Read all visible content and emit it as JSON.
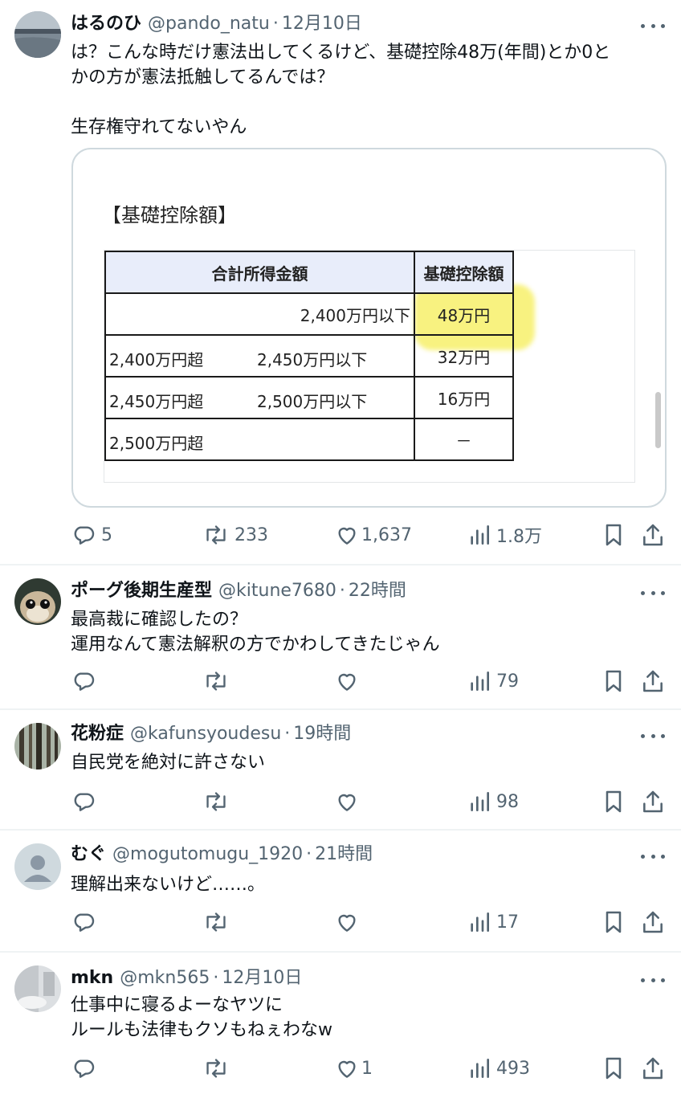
{
  "colors": {
    "text": "#0f1419",
    "muted": "#536471",
    "divider": "#eff3f4",
    "highlight": "#f7f06a",
    "header_bg": "#e8edfa"
  },
  "tweets": [
    {
      "name": "はるのひ",
      "handle": "@pando_natu",
      "time": "12月10日",
      "lines": [
        "は？こんな時だけ憲法出してくるけど、基礎控除48万(年間)とか0と",
        "かの方が憲法抵触してるんでは？",
        "",
        "生存権守れてないやん"
      ],
      "reply_count": "5",
      "retweet_count": "233",
      "like_count": "1,637",
      "view_count": "1.8万",
      "avatar": "lake-photo"
    },
    {
      "name": "ポーグ後期生産型",
      "handle": "@kitune7680",
      "time": "22時間",
      "lines": [
        "最高裁に確認したの？",
        "運用なんて憲法解釈の方でかわしてきたじゃん"
      ],
      "reply_count": "",
      "retweet_count": "",
      "like_count": "",
      "view_count": "79",
      "avatar": "porg-figure"
    },
    {
      "name": "花粉症",
      "handle": "@kafunsyoudesu",
      "time": "19時間",
      "lines": [
        "自民党を絶対に許さない"
      ],
      "reply_count": "",
      "retweet_count": "",
      "like_count": "",
      "view_count": "98",
      "avatar": "forest-photo"
    },
    {
      "name": "むぐ",
      "handle": "@mogutomugu_1920",
      "time": "21時間",
      "lines": [
        "理解出来ないけど……。"
      ],
      "reply_count": "",
      "retweet_count": "",
      "like_count": "",
      "view_count": "17",
      "avatar": "default-user"
    },
    {
      "name": "mkn",
      "handle": "@mkn565",
      "time": "12月10日",
      "lines": [
        "仕事中に寝るよーなヤツに",
        "ルールも法律もクソもねぇわなw"
      ],
      "reply_count": "",
      "retweet_count": "",
      "like_count": "1",
      "view_count": "493",
      "avatar": "gray-photo"
    }
  ],
  "media": {
    "title": "【基礎控除額】",
    "header": [
      "合計所得金額",
      "基礎控除額"
    ],
    "rows": [
      {
        "a": "",
        "b": "2,400万円以下",
        "amount": "48万円"
      },
      {
        "a": "2,400万円超",
        "b": "2,450万円以下",
        "amount": "32万円"
      },
      {
        "a": "2,450万円超",
        "b": "2,500万円以下",
        "amount": "16万円"
      },
      {
        "a": "2,500万円超",
        "b": "",
        "amount": "－"
      }
    ]
  }
}
